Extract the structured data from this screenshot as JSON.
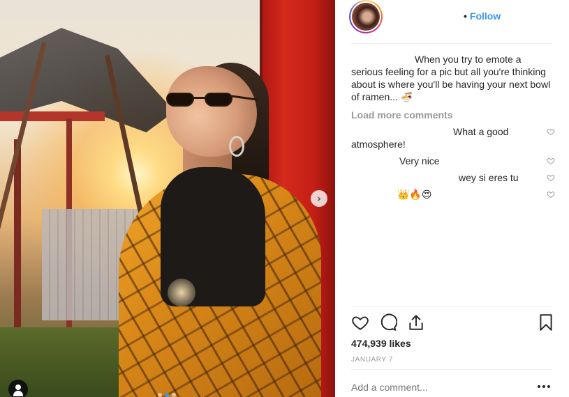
{
  "post": {
    "photo_alt": "woman in sunglasses and plaid coat leaning against red pillar at sunset",
    "carousel_active_index": 1,
    "carousel_count": 3
  },
  "header": {
    "follow_separator": "•",
    "follow_label": "Follow"
  },
  "comments": {
    "caption": "When you try to emote a serious feeling for a pic but all you're thinking about is where you'll be having your next bowl of ramen... 🍜",
    "load_more": "Load more comments",
    "items": [
      {
        "text": "What a good atmosphere!"
      },
      {
        "text": "Very nice"
      },
      {
        "text": "wey si eres tu"
      },
      {
        "text": "👑🔥😍"
      }
    ]
  },
  "actions": {
    "like_icon": "heart-outline-icon",
    "comment_icon": "speech-bubble-icon",
    "share_icon": "share-upload-icon",
    "save_icon": "bookmark-icon"
  },
  "likes": "474,939 likes",
  "date": "JANUARY 7",
  "add_comment": {
    "placeholder": "Add a comment..."
  },
  "colors": {
    "accent": "#3897f0",
    "muted": "#999999",
    "text": "#262626"
  }
}
